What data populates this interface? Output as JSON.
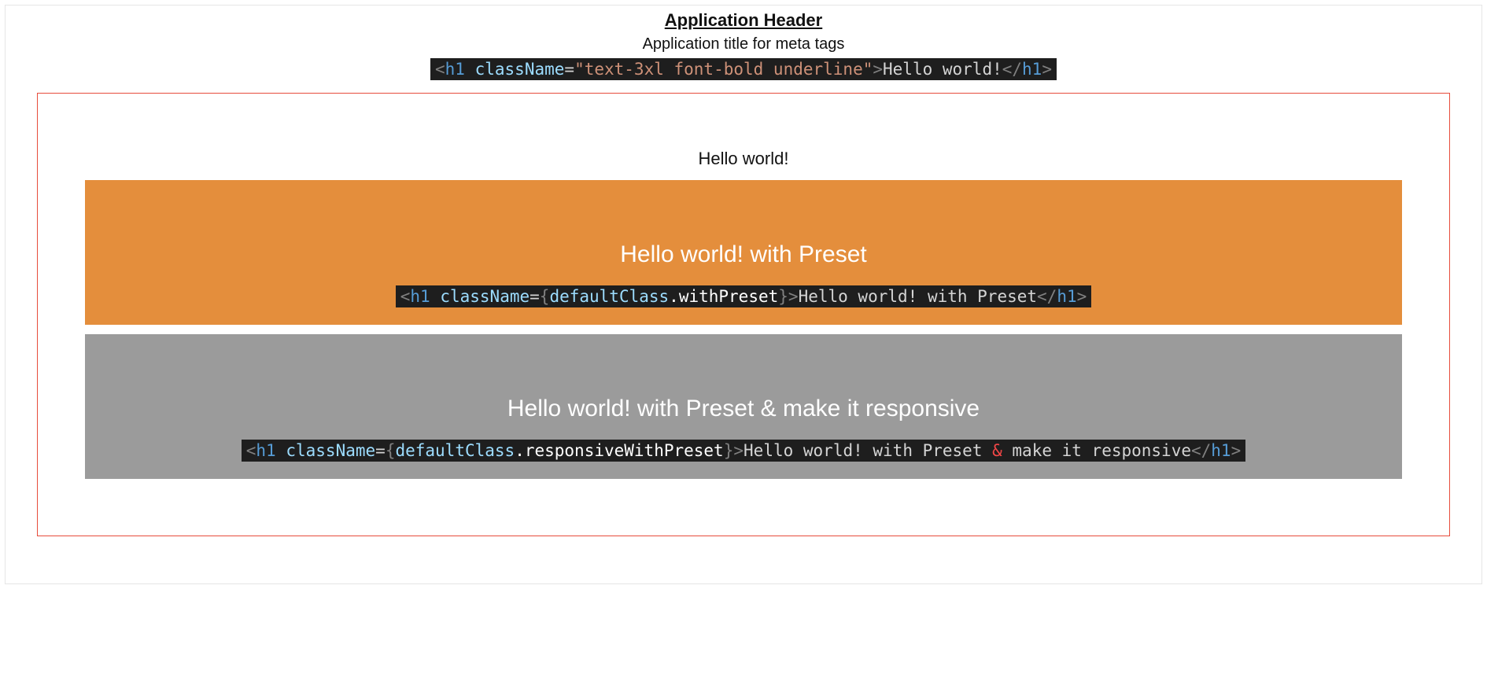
{
  "header": {
    "title": "Application Header",
    "subtitle": "Application title for meta tags"
  },
  "code1": {
    "open_angle": "<",
    "tag": "h1",
    "space": " ",
    "attr": "className",
    "eq": "=",
    "str": "\"text-3xl font-bold underline\"",
    "gt": ">",
    "inner": "Hello world!",
    "close_open": "</",
    "close_tag": "h1",
    "close_gt": ">"
  },
  "demo1": {
    "title": "Hello world!"
  },
  "panelOrange": {
    "bg": "#e48e3c",
    "heading": "Hello world! with Preset",
    "code": {
      "open_angle": "<",
      "tag": "h1",
      "space": " ",
      "attr": "className",
      "eq": "=",
      "lbrace": "{",
      "var1": "defaultClass",
      "dot": ".",
      "var2": "withPreset",
      "rbrace": "}",
      "gt": ">",
      "inner": "Hello world! with Preset",
      "close_open": "</",
      "close_tag": "h1",
      "close_gt": ">"
    }
  },
  "panelGray": {
    "bg": "#9b9b9b",
    "heading": "Hello world! with Preset & make it responsive",
    "code": {
      "open_angle": "<",
      "tag": "h1",
      "space": " ",
      "attr": "className",
      "eq": "=",
      "lbrace": "{",
      "var1": "defaultClass",
      "dot": ".",
      "var2": "responsiveWithPreset",
      "rbrace": "}",
      "gt": ">",
      "inner_a": "Hello world! with Preset ",
      "amp": "&",
      "inner_b": " make it responsive",
      "close_open": "</",
      "close_tag": "h1",
      "close_gt": ">"
    }
  }
}
